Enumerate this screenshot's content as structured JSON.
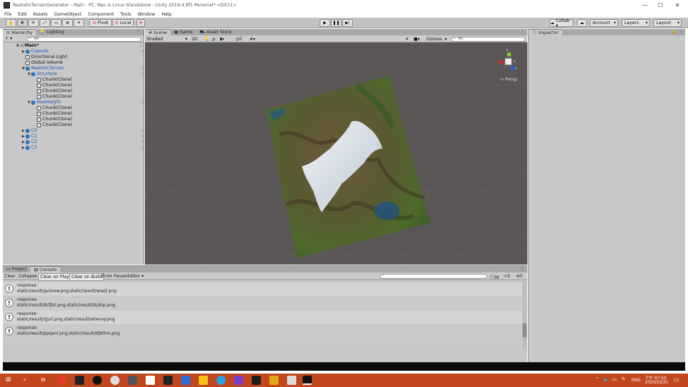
{
  "window": {
    "title": "RealisticTerrainGenerator - Main - PC, Mac & Linux Standalone - Unity 2019.4.9f1 Personal* <DX11>",
    "controls": [
      "—",
      "☐",
      "✕"
    ]
  },
  "menu": [
    "File",
    "Edit",
    "Assets",
    "GameObject",
    "Component",
    "Tools",
    "Window",
    "Help"
  ],
  "toolbar": {
    "pivot_label": "Pivot",
    "local_label": "Local",
    "collab_label": "Collab ▾",
    "account_label": "Account",
    "layers_label": "Layers",
    "layout_label": "Layout"
  },
  "hierarchy": {
    "tabs": [
      "Hierarchy",
      "Lighting"
    ],
    "add_label": "+ ▾",
    "search_placeholder": "All",
    "scene_name": "Main*",
    "items": [
      {
        "label": "Capsule",
        "depth": 1,
        "arrow": "▶",
        "icon": "blue",
        "more": true
      },
      {
        "label": "Directional Light",
        "depth": 1,
        "arrow": "",
        "icon": "gray",
        "more": false
      },
      {
        "label": "Global Volume",
        "depth": 1,
        "arrow": "",
        "icon": "gray",
        "more": false
      },
      {
        "label": "RealisticTerrain",
        "depth": 1,
        "arrow": "▼",
        "icon": "blue",
        "more": true
      },
      {
        "label": "Structure",
        "depth": 2,
        "arrow": "▼",
        "icon": "blue",
        "more": true
      },
      {
        "label": "Chunk(Clone)",
        "depth": 3,
        "arrow": "",
        "icon": "gray",
        "more": false
      },
      {
        "label": "Chunk(Clone)",
        "depth": 3,
        "arrow": "",
        "icon": "gray",
        "more": false
      },
      {
        "label": "Chunk(Clone)",
        "depth": 3,
        "arrow": "",
        "icon": "gray",
        "more": false
      },
      {
        "label": "Chunk(Clone)",
        "depth": 3,
        "arrow": "",
        "icon": "gray",
        "more": false
      },
      {
        "label": "RealHeight",
        "depth": 2,
        "arrow": "▼",
        "icon": "blue",
        "more": true
      },
      {
        "label": "Chunk(Clone)",
        "depth": 3,
        "arrow": "",
        "icon": "gray",
        "more": false
      },
      {
        "label": "Chunk(Clone)",
        "depth": 3,
        "arrow": "",
        "icon": "gray",
        "more": false
      },
      {
        "label": "Chunk(Clone)",
        "depth": 3,
        "arrow": "",
        "icon": "gray",
        "more": false
      },
      {
        "label": "Chunk(Clone)",
        "depth": 3,
        "arrow": "",
        "icon": "gray",
        "more": false
      },
      {
        "label": "C0",
        "depth": 1,
        "arrow": "▶",
        "icon": "blue",
        "more": true
      },
      {
        "label": "C1",
        "depth": 1,
        "arrow": "▶",
        "icon": "blue",
        "more": true
      },
      {
        "label": "C2",
        "depth": 1,
        "arrow": "▶",
        "icon": "blue",
        "more": true
      },
      {
        "label": "C3",
        "depth": 1,
        "arrow": "▶",
        "icon": "blue",
        "more": true
      }
    ]
  },
  "scene": {
    "tabs": [
      "Scene",
      "Game",
      "Asset Store"
    ],
    "shading_mode": "Shaded",
    "dim_toggle": "2D",
    "gizmos_label": "Gizmos",
    "search_placeholder": "All",
    "persp_label": "< Persp",
    "axes": {
      "y": "y",
      "x": "x",
      "z": "z"
    }
  },
  "inspector": {
    "tab": "Inspector"
  },
  "console": {
    "tabs": [
      "Project",
      "Console"
    ],
    "buttons": [
      "Clear",
      "Collapse",
      "Clear on Play",
      "Clear on Build",
      "Error Pause",
      "Editor ▾"
    ],
    "counts": {
      "log": "38",
      "warn": "0",
      "error": "0"
    },
    "entries": [
      {
        "line1": "response:",
        "line2": "static/result/gvzoow.png,static/result/wazjl.png"
      },
      {
        "line1": "response:",
        "line2": "static/result/dcfjbz.png,static/result/ikjshp.png"
      },
      {
        "line1": "response:",
        "line2": "static/result/rjjuri.png,static/result/wlwvxy.png"
      },
      {
        "line1": "response:",
        "line2": "static/result/ppqanl.png,static/result/djbthm.png"
      }
    ]
  },
  "taskbar": {
    "tray_lang": "ENG",
    "time": "下午 07:50",
    "date": "2020/10/31"
  },
  "colors": {
    "taskbar": "#c2461e",
    "scene_bg": "#5a5656",
    "panel": "#c8c8c8",
    "selection_blue": "#1b52b0"
  }
}
